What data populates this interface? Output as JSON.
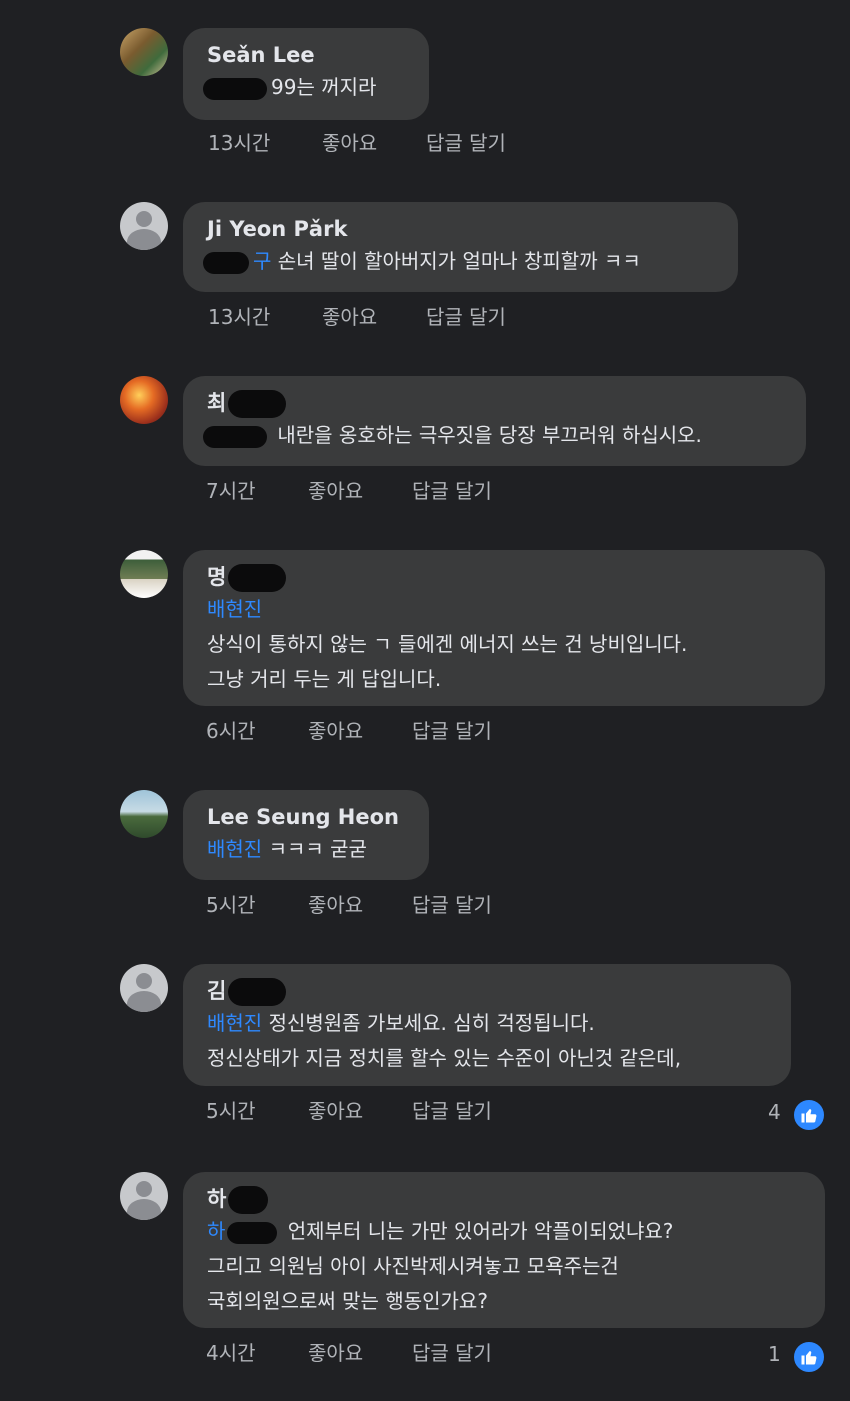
{
  "comments": [
    {
      "author": "Seǎn Lee",
      "lines": [
        "99는 꺼지라"
      ],
      "mention": "",
      "time": "13시간",
      "like_label": "좋아요",
      "reply_label": "답글 달기",
      "reactions": ""
    },
    {
      "author": "Ji Yeon Pǎrk",
      "lines": [
        "손녀 딸이 할아버지가 얼마나 창피할까 ㅋㅋ"
      ],
      "mention": "구",
      "time": "13시간",
      "like_label": "좋아요",
      "reply_label": "답글 달기",
      "reactions": ""
    },
    {
      "author": "최",
      "lines": [
        "내란을 옹호하는 극우짓을 당장 부끄러워 하십시오."
      ],
      "mention": "",
      "time": "7시간",
      "like_label": "좋아요",
      "reply_label": "답글 달기",
      "reactions": ""
    },
    {
      "author": "명",
      "mention": "배현진",
      "lines": [
        "상식이 통하지 않는 ㄱ 들에겐 에너지 쓰는 건 낭비입니다.",
        "그냥 거리 두는 게 답입니다."
      ],
      "time": "6시간",
      "like_label": "좋아요",
      "reply_label": "답글 달기",
      "reactions": ""
    },
    {
      "author": "Lee Seung Heon",
      "mention": "배현진",
      "lines": [
        "ㅋㅋㅋ 굳굳"
      ],
      "time": "5시간",
      "like_label": "좋아요",
      "reply_label": "답글 달기",
      "reactions": ""
    },
    {
      "author": "김",
      "mention": "배현진",
      "lines": [
        "정신병원좀 가보세요. 심히 걱정됩니다.",
        "정신상태가 지금 정치를 할수 있는 수준이 아닌것 같은데,"
      ],
      "time": "5시간",
      "like_label": "좋아요",
      "reply_label": "답글 달기",
      "reactions": "4"
    },
    {
      "author": "하",
      "mention": "하",
      "lines": [
        "언제부터 니는 가만 있어라가 악플이되었냐요?",
        "그리고 의원님 아이 사진박제시켜놓고 모욕주는건",
        "국회의원으로써 맞는 행동인가요?"
      ],
      "time": "4시간",
      "like_label": "좋아요",
      "reply_label": "답글 달기",
      "reactions": "1"
    }
  ],
  "colors": {
    "background": "#1f2023",
    "bubble": "#3a3b3c",
    "mention": "#2e89ff",
    "like": "#2d88ff"
  },
  "icons": {
    "like": "thumbs-up-icon",
    "avatar_default": "default-avatar-icon"
  }
}
